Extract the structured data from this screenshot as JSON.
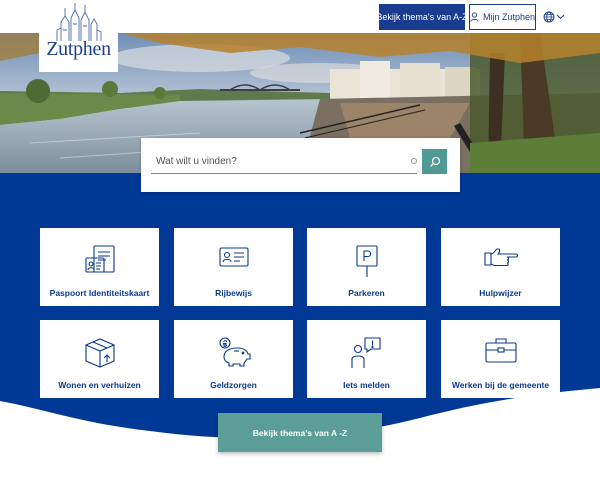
{
  "header": {
    "logo_text": "Zutphen",
    "az_button_label": "Bekijk thema's van A-Z",
    "mijn_label": "Mijn Zutphen",
    "language_icon": "globe-icon"
  },
  "search": {
    "placeholder": "Wat wilt u vinden?",
    "button_icon": "search-icon"
  },
  "tiles": [
    {
      "label": "Paspoort Identiteitskaart",
      "icon": "passport-icon"
    },
    {
      "label": "Rijbewijs",
      "icon": "drivers-license-icon"
    },
    {
      "label": "Parkeren",
      "icon": "parking-sign-icon"
    },
    {
      "label": "Hulpwijzer",
      "icon": "pointing-hand-icon"
    },
    {
      "label": "Wonen en verhuizen",
      "icon": "moving-box-icon"
    },
    {
      "label": "Geldzorgen",
      "icon": "piggy-bank-icon"
    },
    {
      "label": "Iets melden",
      "icon": "report-person-icon"
    },
    {
      "label": "Werken bij de gemeente",
      "icon": "briefcase-icon"
    }
  ],
  "footer_cta": {
    "label": "Bekijk thema's van A -Z"
  },
  "colors": {
    "brand_blue": "#003896",
    "button_blue": "#1a3c8f",
    "accent_teal": "#5a9e97"
  }
}
